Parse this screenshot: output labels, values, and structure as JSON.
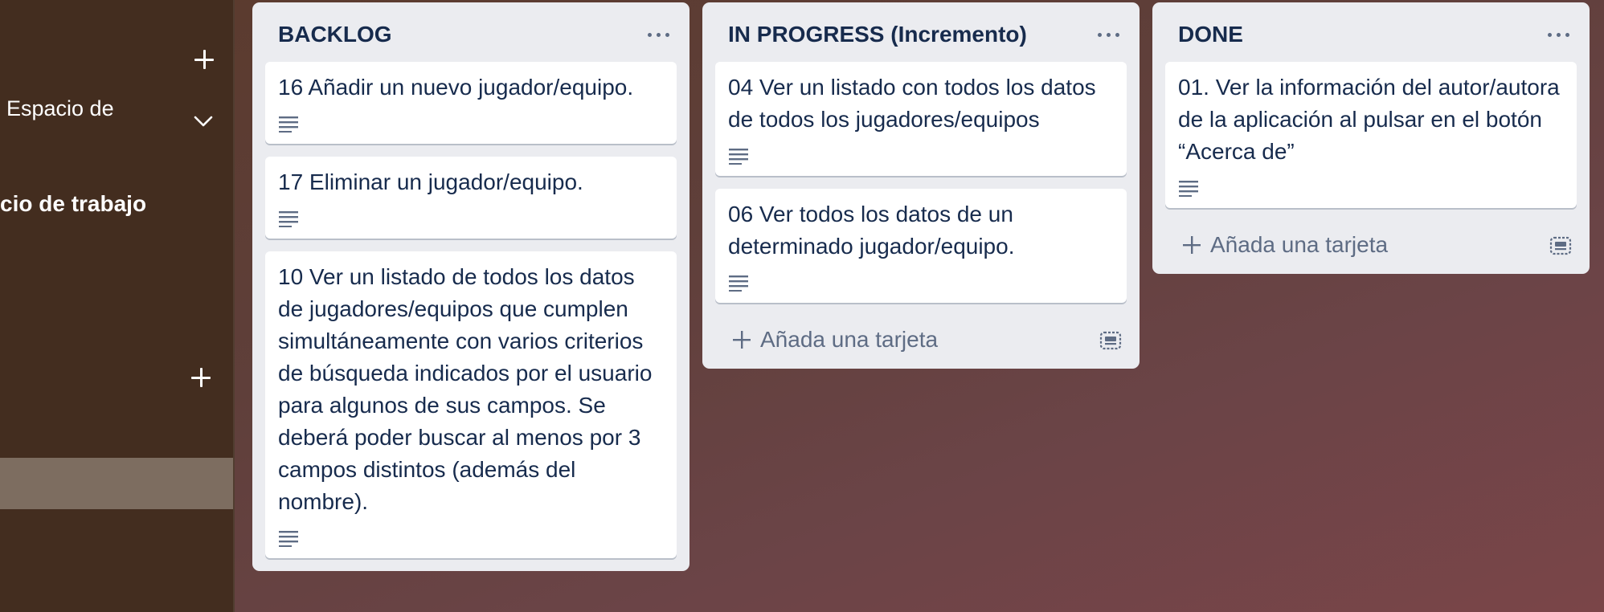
{
  "sidebar": {
    "workspace_text": "Espacio de",
    "workspace_settings_text": "cio de trabajo"
  },
  "lists": [
    {
      "title": "BACKLOG",
      "cards": [
        {
          "text": "16 Añadir un nuevo jugador/equipo."
        },
        {
          "text": "17 Eliminar un jugador/equipo."
        },
        {
          "text": "10 Ver un listado de todos los datos de jugadores/equipos que cumplen simultáneamente con varios criterios de búsqueda indicados por el usuario para algunos de sus campos. Se deberá poder buscar al menos por 3 campos distintos (además del nombre)."
        }
      ]
    },
    {
      "title": "IN PROGRESS (Incremento)",
      "cards": [
        {
          "text": "04 Ver un listado con todos los datos de todos los jugadores/equipos"
        },
        {
          "text": "06 Ver todos los datos de un determinado jugador/equipo."
        }
      ],
      "add_card_label": "Añada una tarjeta"
    },
    {
      "title": "DONE",
      "cards": [
        {
          "text": "01. Ver la información del autor/autora de la aplicación al pulsar en el botón “Acerca de”"
        }
      ],
      "add_card_label": "Añada una tarjeta"
    }
  ],
  "icons": {
    "list_menu": "more-horizontal-icon",
    "description": "description-lines-icon",
    "add": "plus-icon",
    "template": "card-template-icon"
  },
  "colors": {
    "list_bg": "#ebecf0",
    "card_bg": "#ffffff",
    "text": "#172b4d",
    "muted": "#5e6c84",
    "sidebar_bg": "#432d1f"
  }
}
